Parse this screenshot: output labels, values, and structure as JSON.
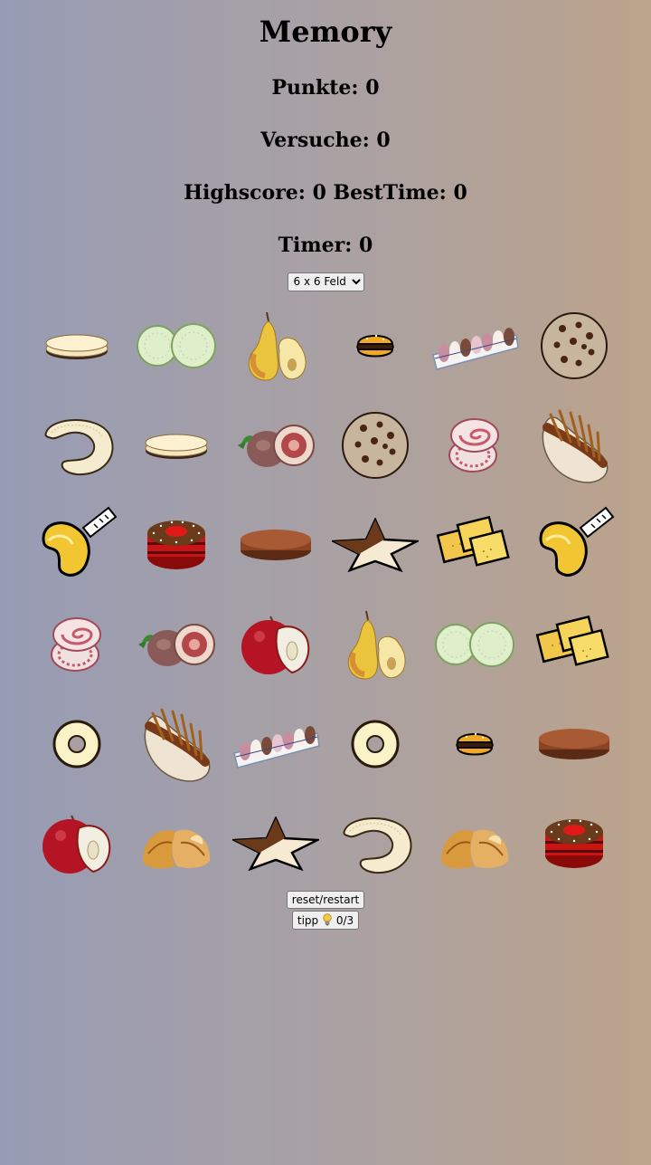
{
  "title": "Memory",
  "stats": {
    "punkte_label": "Punkte: 0",
    "versuche_label": "Versuche: 0",
    "highscore_label": "Highscore: 0 BestTime: 0",
    "timer_label": "Timer: 0"
  },
  "board_select": {
    "selected": "6 x 6 Feld"
  },
  "cards": [
    [
      "wafer",
      "cucumber",
      "pear",
      "burger",
      "cookie-box",
      "cookie"
    ],
    [
      "pretzel",
      "wafer",
      "fig",
      "cookie",
      "salami",
      "hotdog"
    ],
    [
      "fortune-cookie",
      "cake",
      "pie-disc",
      "star",
      "crackers",
      "fortune-cookie"
    ],
    [
      "salami",
      "fig",
      "apple",
      "pear",
      "cucumber",
      "crackers"
    ],
    [
      "ring",
      "hotdog",
      "cookie-box",
      "ring",
      "burger",
      "pie-disc"
    ],
    [
      "apple",
      "croissant",
      "star",
      "pretzel",
      "croissant",
      "cake"
    ]
  ],
  "buttons": {
    "reset_label": "reset/restart",
    "tipp_label": "tipp",
    "tipp_count": "0/3"
  },
  "colors": {
    "background_left": "#979cb4",
    "background_right": "#bca38b"
  }
}
